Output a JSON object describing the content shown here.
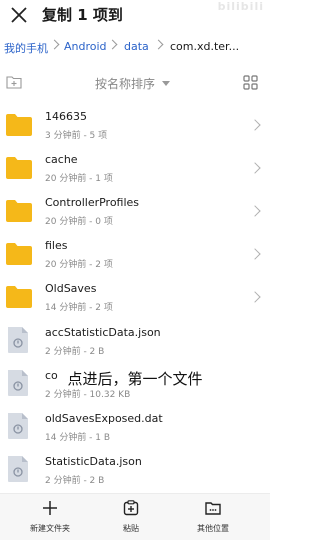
{
  "header": {
    "title": "复制 1 项到",
    "watermark": "bilibili"
  },
  "breadcrumb": {
    "items": [
      "我的手机",
      "Android",
      "data",
      "com.xd.ter..."
    ]
  },
  "toolbar": {
    "sort_label": "按名称排序"
  },
  "files": [
    {
      "name": "146635",
      "meta": "3 分钟前 - 5 项",
      "type": "folder"
    },
    {
      "name": "cache",
      "meta": "20 分钟前 - 1 项",
      "type": "folder"
    },
    {
      "name": "ControllerProfiles",
      "meta": "20 分钟前 - 0 项",
      "type": "folder"
    },
    {
      "name": "files",
      "meta": "20 分钟前 - 2 项",
      "type": "folder"
    },
    {
      "name": "OldSaves",
      "meta": "14 分钟前 - 2 项",
      "type": "folder"
    },
    {
      "name": "accStatisticData.json",
      "meta": "2 分钟前 - 2 B",
      "type": "file"
    },
    {
      "name": "co",
      "meta": "2 分钟前 - 10.32 KB",
      "type": "file"
    },
    {
      "name": "oldSavesExposed.dat",
      "meta": "14 分钟前 - 1 B",
      "type": "file"
    },
    {
      "name": "StatisticData.json",
      "meta": "2 分钟前 - 2 B",
      "type": "file"
    }
  ],
  "subtitle_overlay": "点进后，第一个文件",
  "bottom_bar": {
    "new_folder": "新建文件夹",
    "paste": "粘贴",
    "other_location": "其他位置"
  },
  "colors": {
    "folder": "#f5b819",
    "link": "#2b63c9",
    "file_icon": "#d6dbe3"
  }
}
